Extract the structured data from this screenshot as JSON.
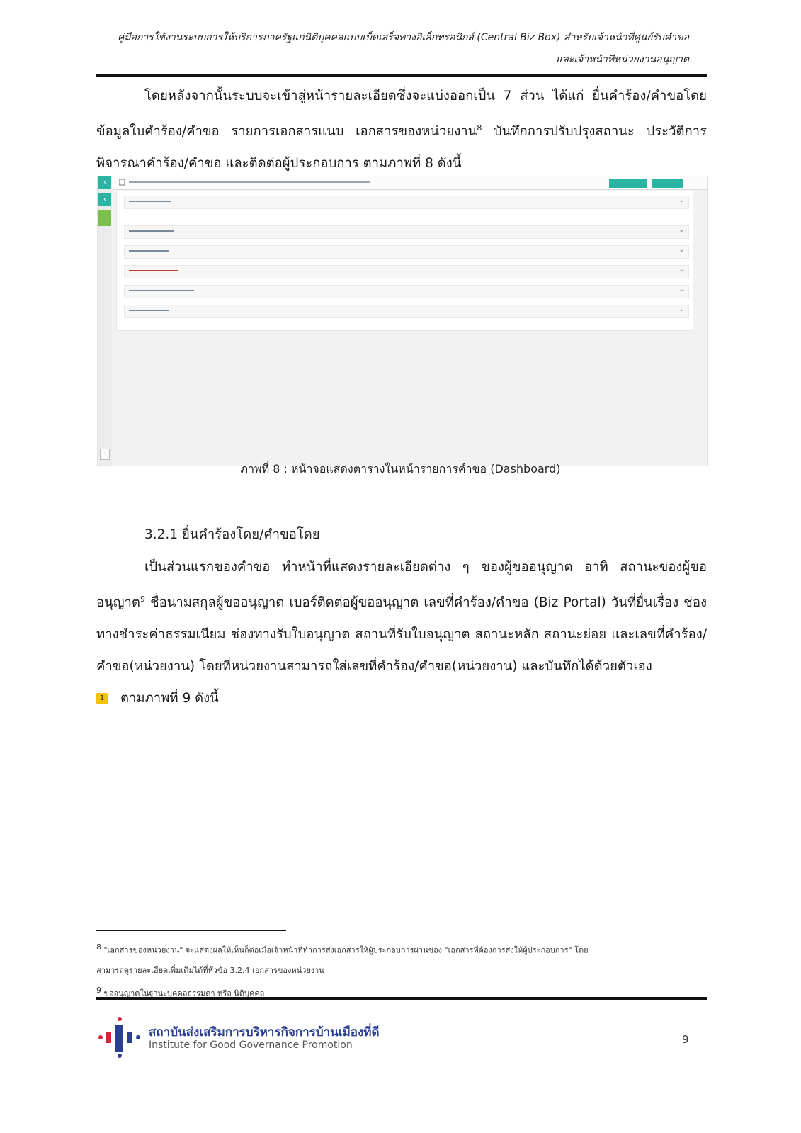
{
  "header": {
    "line1": "คู่มือการใช้งานระบบการให้บริการภาครัฐแก่นิติบุคคลแบบเบ็ดเสร็จทางอิเล็กทรอนิกส์ (Central Biz Box) สำหรับเจ้าหน้าที่ศูนย์รับคำขอ",
    "line2": "และเจ้าหน้าที่หน่วยงานอนุญาต"
  },
  "intro_paragraph": {
    "before_sup": "โดยหลังจากนั้นระบบจะเข้าสู่หน้ารายละเอียดซึ่งจะแบ่งออกเป็น 7 ส่วน ได้แก่ ยื่นคำร้อง/คำขอโดย ข้อมูลใบคำร้อง/คำขอ รายการเอกสารแนบ เอกสารของหน่วยงาน",
    "sup": "8",
    "after_sup": " บันทึกการปรับปรุงสถานะ ประวัติการพิจารณาคำร้อง/คำขอ และติดต่อผู้ประกอบการ ตามภาพที่ 8 ดังนี้"
  },
  "figure": {
    "caption": "ภาพที่ 8 : หน้าจอแสดงตารางในหน้ารายการคำขอ (Dashboard)"
  },
  "section": {
    "heading": "3.2.1 ยื่นคำร้องโดย/คำขอโดย",
    "before_sup": "เป็นส่วนแรกของคำขอ ทำหน้าที่แสดงรายละเอียดต่าง ๆ ของผู้ขออนุญาต อาทิ สถานะของผู้ขออนุญาต",
    "sup": "9",
    "after_sup": " ชื่อนามสกุลผู้ขออนุญาต เบอร์ติดต่อผู้ขออนุญาต เลขที่คำร้อง/คำขอ (Biz Portal) วันที่ยื่นเรื่อง ช่องทางชำระค่าธรรมเนียม ช่องทางรับใบอนุญาต สถานที่รับใบอนุญาต สถานะหลัก สถานะย่อย และเลขที่คำร้อง/คำขอ(หน่วยงาน) โดยที่หน่วยงานสามารถใส่เลขที่คำร้อง/คำขอ(หน่วยงาน) และบันทึกได้ด้วยตัวเอง",
    "badge": "1",
    "last_line": "ตามภาพที่ 9 ดังนี้"
  },
  "footnotes": {
    "fn8_num": "8",
    "fn8_line1": "\"เอกสารของหน่วยงาน\" จะแสดงผลให้เห็นก็ต่อเมื่อเจ้าหน้าที่ทำการส่งเอกสารให้ผู้ประกอบการผ่านช่อง \"เอกสารที่ต้องการส่งให้ผู้ประกอบการ\" โดย",
    "fn8_line2": "สามารถดูรายละเอียดเพิ่มเติมได้ที่หัวข้อ 3.2.4 เอกสารของหน่วยงาน",
    "fn9_num": "9",
    "fn9_line1": "ขออนุญาตในฐานะบุคคลธรรมดา หรือ นิติบุคคล"
  },
  "footer": {
    "org_th": "สถาบันส่งเสริมการบริหารกิจการบ้านเมืองที่ดี",
    "org_en": "Institute for Good Governance Promotion",
    "page_number": "9"
  },
  "colors": {
    "teal": "#2ab4a3",
    "green": "#7cbf4a",
    "logo_blue": "#2a3f8f",
    "logo_red": "#d6243a",
    "badge_yellow": "#f2c300"
  }
}
